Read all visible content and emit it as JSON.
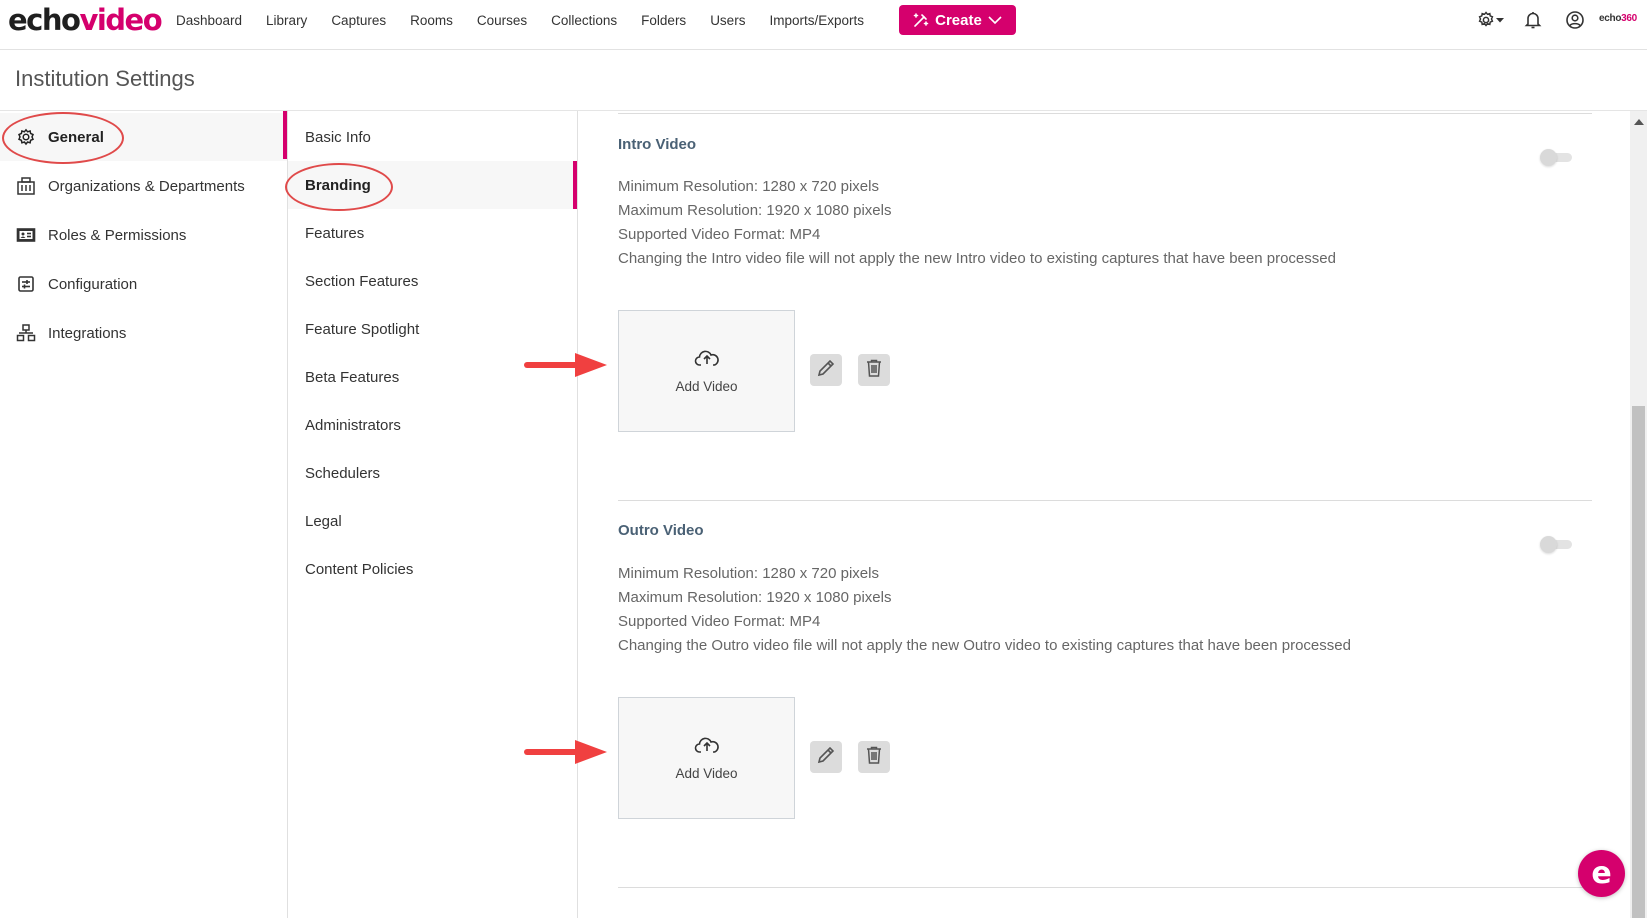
{
  "app": {
    "logo_part1": "echo",
    "logo_part2": "video",
    "brand_color": "#d5006d"
  },
  "nav": {
    "items": [
      "Dashboard",
      "Library",
      "Captures",
      "Rooms",
      "Courses",
      "Collections",
      "Folders",
      "Users",
      "Imports/Exports"
    ],
    "create_label": "Create"
  },
  "top_right": {
    "settings_icon": "gear-icon",
    "notifications_icon": "bell-icon",
    "profile_icon": "user-circle-icon",
    "brand_part1": "echo",
    "brand_part2": "360"
  },
  "page": {
    "title": "Institution Settings"
  },
  "sidebar": {
    "items": [
      {
        "label": "General",
        "icon": "gear-icon",
        "active": true
      },
      {
        "label": "Organizations & Departments",
        "icon": "building-icon",
        "active": false
      },
      {
        "label": "Roles & Permissions",
        "icon": "id-card-icon",
        "active": false
      },
      {
        "label": "Configuration",
        "icon": "sliders-icon",
        "active": false
      },
      {
        "label": "Integrations",
        "icon": "network-icon",
        "active": false
      }
    ]
  },
  "subnav": {
    "items": [
      {
        "label": "Basic Info",
        "active": false
      },
      {
        "label": "Branding",
        "active": true
      },
      {
        "label": "Features",
        "active": false
      },
      {
        "label": "Section Features",
        "active": false
      },
      {
        "label": "Feature Spotlight",
        "active": false
      },
      {
        "label": "Beta Features",
        "active": false
      },
      {
        "label": "Administrators",
        "active": false
      },
      {
        "label": "Schedulers",
        "active": false
      },
      {
        "label": "Legal",
        "active": false
      },
      {
        "label": "Content Policies",
        "active": false
      }
    ]
  },
  "sections": [
    {
      "title": "Intro Video",
      "enabled": false,
      "lines": [
        "Minimum Resolution: 1280 x 720 pixels",
        "Maximum Resolution: 1920 x 1080 pixels",
        "Supported Video Format: MP4",
        "Changing the Intro video file will not apply the new Intro video to existing captures that have been processed"
      ],
      "upload_label": "Add Video"
    },
    {
      "title": "Outro Video",
      "enabled": false,
      "lines": [
        "Minimum Resolution: 1280 x 720 pixels",
        "Maximum Resolution: 1920 x 1080 pixels",
        "Supported Video Format: MP4",
        "Changing the Outro video file will not apply the new Outro video to existing captures that have been processed"
      ],
      "upload_label": "Add Video"
    }
  ],
  "chat": {
    "label": "e"
  }
}
